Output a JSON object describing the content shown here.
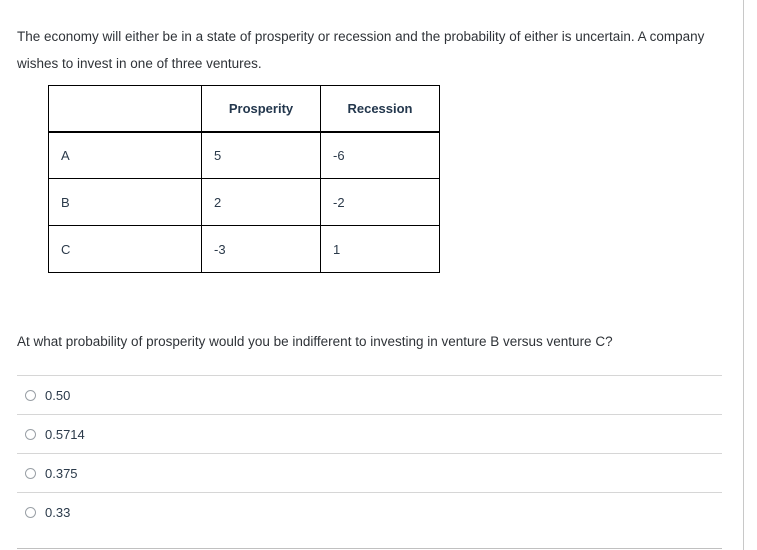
{
  "stem": {
    "text": "The economy will either be in a state of prosperity or recession and the probability of either is uncertain.  A company wishes to invest in one of three ventures."
  },
  "payoff_table": {
    "corner_header": "",
    "column_headers": [
      "Prosperity",
      "Recession"
    ],
    "rows": [
      {
        "label": "A",
        "prosperity": "5",
        "recession": "-6"
      },
      {
        "label": "B",
        "prosperity": "2",
        "recession": "-2"
      },
      {
        "label": "C",
        "prosperity": "-3",
        "recession": "1"
      }
    ]
  },
  "question": {
    "text": "At what probability of prosperity would you be indifferent to investing in venture B versus venture C?"
  },
  "answers": {
    "selected": null,
    "options": [
      {
        "label": "0.50",
        "selected": false
      },
      {
        "label": "0.5714",
        "selected": false
      },
      {
        "label": "0.375",
        "selected": false
      },
      {
        "label": "0.33",
        "selected": false
      }
    ]
  },
  "colors": {
    "text": "#2f3338",
    "table_text": "#2b3a4a",
    "table_border": "#000000",
    "divider": "#d6d6d6",
    "pane_rule": "#c8c8c8"
  }
}
